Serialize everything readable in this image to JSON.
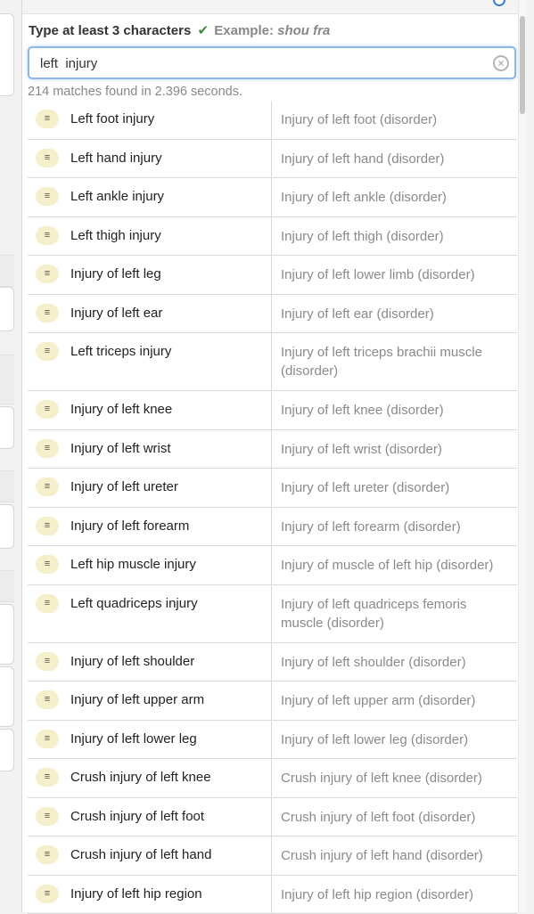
{
  "search": {
    "hint_text": "Type at least 3 characters",
    "check_glyph": "✔",
    "example_label": "Example:",
    "example_value": "shou fra",
    "value": "left  injury",
    "clear_glyph": "×",
    "status": "214 matches found in 2.396 seconds."
  },
  "badge_glyph": "≡",
  "results": [
    {
      "term": "Left foot injury",
      "desc": "Injury of left foot (disorder)"
    },
    {
      "term": "Left hand injury",
      "desc": "Injury of left hand (disorder)"
    },
    {
      "term": "Left ankle injury",
      "desc": "Injury of left ankle (disorder)"
    },
    {
      "term": "Left thigh injury",
      "desc": "Injury of left thigh (disorder)"
    },
    {
      "term": "Injury of left leg",
      "desc": "Injury of left lower limb (disorder)"
    },
    {
      "term": "Injury of left ear",
      "desc": "Injury of left ear (disorder)"
    },
    {
      "term": "Left triceps injury",
      "desc": "Injury of left triceps brachii muscle (disorder)"
    },
    {
      "term": "Injury of left knee",
      "desc": "Injury of left knee (disorder)"
    },
    {
      "term": "Injury of left wrist",
      "desc": "Injury of left wrist (disorder)"
    },
    {
      "term": "Injury of left ureter",
      "desc": "Injury of left ureter (disorder)"
    },
    {
      "term": "Injury of left forearm",
      "desc": "Injury of left forearm (disorder)"
    },
    {
      "term": "Left hip muscle injury",
      "desc": "Injury of muscle of left hip (disorder)"
    },
    {
      "term": "Left quadriceps injury",
      "desc": "Injury of left quadriceps femoris muscle (disorder)"
    },
    {
      "term": "Injury of left shoulder",
      "desc": "Injury of left shoulder (disorder)"
    },
    {
      "term": "Injury of left upper arm",
      "desc": "Injury of left upper arm (disorder)"
    },
    {
      "term": "Injury of left lower leg",
      "desc": "Injury of left lower leg (disorder)"
    },
    {
      "term": "Crush injury of left knee",
      "desc": "Crush injury of left knee (disorder)"
    },
    {
      "term": "Crush injury of left foot",
      "desc": "Crush injury of left foot (disorder)"
    },
    {
      "term": "Crush injury of left hand",
      "desc": "Crush injury of left hand (disorder)"
    },
    {
      "term": "Injury of left hip region",
      "desc": "Injury of left hip region (disorder)"
    }
  ]
}
